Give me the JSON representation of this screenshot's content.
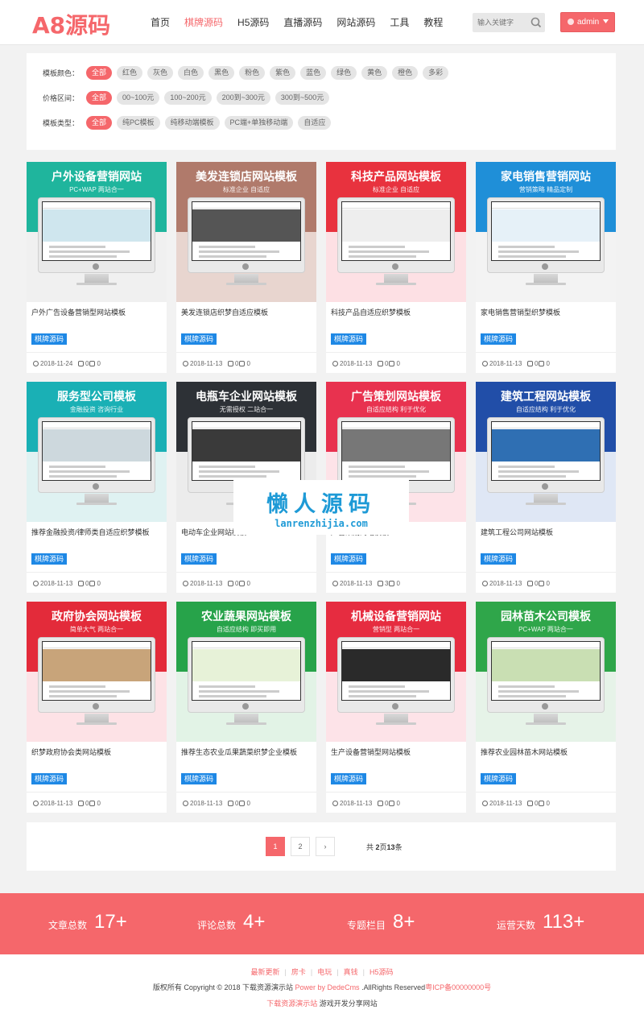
{
  "header": {
    "logo": "A8源码",
    "nav": [
      "首页",
      "棋牌源码",
      "H5源码",
      "直播源码",
      "网站源码",
      "工具",
      "教程"
    ],
    "nav_active": 1,
    "search_placeholder": "输入关键字",
    "user": "admin"
  },
  "filters": [
    {
      "label": "模板颜色：",
      "options": [
        "全部",
        "红色",
        "灰色",
        "白色",
        "黑色",
        "粉色",
        "紫色",
        "蓝色",
        "绿色",
        "黄色",
        "橙色",
        "多彩"
      ]
    },
    {
      "label": "价格区间：",
      "options": [
        "全部",
        "00~100元",
        "100~200元",
        "200到~300元",
        "300到~500元"
      ]
    },
    {
      "label": "模板类型：",
      "options": [
        "全部",
        "纯PC模板",
        "纯移动端模板",
        "PC端+单独移动端",
        "自适应"
      ]
    }
  ],
  "cards": [
    {
      "title": "户外设备营销网站",
      "sub": "PC+WAP 两站合一",
      "name": "户外广告设备营销型网站模板",
      "date": "2018-11-24",
      "comments": "0",
      "likes": "0",
      "top": "#1fb59d",
      "bottom": "#f0f0f0",
      "banner": "#cfe6ee"
    },
    {
      "title": "美发连锁店网站模板",
      "sub": "标准企业 自适应",
      "name": "美发连锁店织梦自适应模板",
      "date": "2018-11-13",
      "comments": "0",
      "likes": "0",
      "top": "#b07a6b",
      "bottom": "#e8d5cf",
      "banner": "#555555"
    },
    {
      "title": "科技产品网站模板",
      "sub": "标准企业 自适应",
      "name": "科技产品自适应织梦模板",
      "date": "2018-11-13",
      "comments": "0",
      "likes": "0",
      "top": "#e8323e",
      "bottom": "#fde0e4",
      "banner": "#eeeeee"
    },
    {
      "title": "家电销售营销网站",
      "sub": "营销策略 精品定制",
      "name": "家电销售营销型织梦模板",
      "date": "2018-11-13",
      "comments": "0",
      "likes": "0",
      "top": "#1f8fd8",
      "bottom": "#f3f3f3",
      "banner": "#e6f1f8"
    },
    {
      "title": "服务型公司模板",
      "sub": "金融投资 咨询行业",
      "name": "推荐金融投资/律师类自适应织梦模板",
      "date": "2018-11-13",
      "comments": "0",
      "likes": "0",
      "top": "#1ab0b5",
      "bottom": "#dff2f2",
      "banner": "#cdd8dd"
    },
    {
      "title": "电瓶车企业网站模板",
      "sub": "无需授权 二站合一",
      "name": "电动车企业网站模板",
      "date": "2018-11-13",
      "comments": "0",
      "likes": "0",
      "top": "#2d3136",
      "bottom": "#ececec",
      "banner": "#3a3a3a"
    },
    {
      "title": "广告策划网站模板",
      "sub": "自适应结构 利于优化",
      "name": "广告策划网站模板",
      "date": "2018-11-13",
      "comments": "3",
      "likes": "0",
      "top": "#e8324f",
      "bottom": "#fde3e8",
      "banner": "#777777"
    },
    {
      "title": "建筑工程网站模板",
      "sub": "自适应结构 利于优化",
      "name": "建筑工程公司网站模板",
      "date": "2018-11-13",
      "comments": "0",
      "likes": "0",
      "top": "#214ea8",
      "bottom": "#dfe7f5",
      "banner": "#2f6fb3"
    },
    {
      "title": "政府协会网站模板",
      "sub": "简单大气 两站合一",
      "name": "织梦政府协会类网站模板",
      "date": "2018-11-13",
      "comments": "0",
      "likes": "0",
      "top": "#e32b3a",
      "bottom": "#fde2e6",
      "banner": "#c8a47a"
    },
    {
      "title": "农业蔬果网站模板",
      "sub": "自适应结构 即买即用",
      "name": "推荐生态农业瓜果蔬菜织梦企业模板",
      "date": "2018-11-13",
      "comments": "0",
      "likes": "0",
      "top": "#27a34a",
      "bottom": "#e2f3e6",
      "banner": "#e7f2d8"
    },
    {
      "title": "机械设备营销网站",
      "sub": "营销型 两站合一",
      "name": "生产设备营销型网站模板",
      "date": "2018-11-13",
      "comments": "0",
      "likes": "0",
      "top": "#e62c40",
      "bottom": "#fde3e8",
      "banner": "#2a2a2a"
    },
    {
      "title": "园林苗木公司模板",
      "sub": "PC+WAP 两站合一",
      "name": "推荐农业园林苗木网站模板",
      "date": "2018-11-13",
      "comments": "0",
      "likes": "0",
      "top": "#2fa64a",
      "bottom": "#e6f3e8",
      "banner": "#c9dfb3"
    }
  ],
  "card_badge": "棋牌源码",
  "watermark": {
    "cn": "懒人源码",
    "en": "lanrenzhijia.com"
  },
  "pager": {
    "pages": [
      "1",
      "2"
    ],
    "current": "1",
    "next": "›",
    "info_pre": "共 ",
    "info_pages": "2",
    "info_mid": "页",
    "info_total": "13",
    "info_suf": "条"
  },
  "stats": [
    {
      "label": "文章总数",
      "value": "17+"
    },
    {
      "label": "评论总数",
      "value": "4+"
    },
    {
      "label": "专题栏目",
      "value": "8+"
    },
    {
      "label": "运营天数",
      "value": "113+"
    }
  ],
  "footer": {
    "links": [
      "最新更新",
      "房卡",
      "电玩",
      "真钱",
      "H5源码"
    ],
    "copyright": "版权所有 Copyright © 2018 下载资源演示站 ",
    "power": "Power by DedeCms",
    "rights": " .AllRights Reserved",
    "icp": "粤ICP备00000000号",
    "site": "下载资源演示站",
    "tagline": " 游戏开发分享网站"
  },
  "colors": {
    "accent": "#f5676b",
    "badge": "#1e88e5",
    "watermark": "#1e9ad6"
  }
}
